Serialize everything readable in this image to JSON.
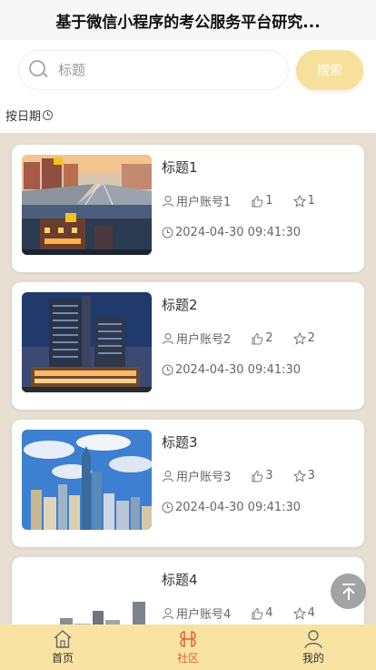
{
  "header": {
    "title": "基于微信小程序的考公服务平台研究..."
  },
  "search": {
    "placeholder": "标题",
    "value": "",
    "button_label": "搜索"
  },
  "sort": {
    "label": "按日期"
  },
  "posts": [
    {
      "title": "标题1",
      "user": "用户账号1",
      "likes": "1",
      "stars": "1",
      "time": "2024-04-30 09:41:30",
      "image": "street-buildings"
    },
    {
      "title": "标题2",
      "user": "用户账号2",
      "likes": "2",
      "stars": "2",
      "time": "2024-04-30 09:41:30",
      "image": "night-towers"
    },
    {
      "title": "标题3",
      "user": "用户账号3",
      "likes": "3",
      "stars": "3",
      "time": "2024-04-30 09:41:30",
      "image": "city-skyline"
    },
    {
      "title": "标题4",
      "user": "用户账号4",
      "likes": "4",
      "stars": "4",
      "time": "",
      "image": "grey-buildings"
    }
  ],
  "tabbar": {
    "items": [
      {
        "label": "首页",
        "icon": "home-icon",
        "active": false
      },
      {
        "label": "社区",
        "icon": "community-icon",
        "active": true
      },
      {
        "label": "我的",
        "icon": "person-icon",
        "active": false
      }
    ]
  },
  "colors": {
    "accent": "#e0623a",
    "tabbar_bg": "#f9e3a3",
    "search_button": "#f7e09b",
    "page_bg": "#e6dfd2"
  }
}
